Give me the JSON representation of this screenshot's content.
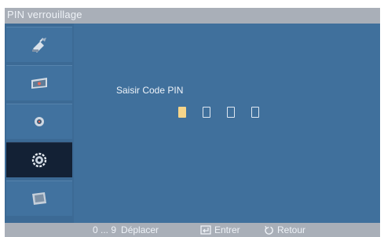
{
  "window": {
    "title": "PIN verrouillage"
  },
  "sidebar": {
    "items": [
      {
        "icon": "satellite-icon",
        "selected": false
      },
      {
        "icon": "picture-icon",
        "selected": false
      },
      {
        "icon": "sound-icon",
        "selected": false
      },
      {
        "icon": "settings-gear-icon",
        "selected": true
      },
      {
        "icon": "input-icon",
        "selected": false
      }
    ]
  },
  "main": {
    "pin_label": "Saisir Code PIN",
    "pin_digit_count": 4,
    "pin_active_index": 0
  },
  "footer": {
    "move_key": "0 ... 9",
    "move_label": "Déplacer",
    "enter_label": "Entrer",
    "return_label": "Retour"
  },
  "colors": {
    "background": "#40709c",
    "bar": "#a9afb8",
    "active_item": "#132135",
    "pin_cursor": "#f6d58a"
  }
}
